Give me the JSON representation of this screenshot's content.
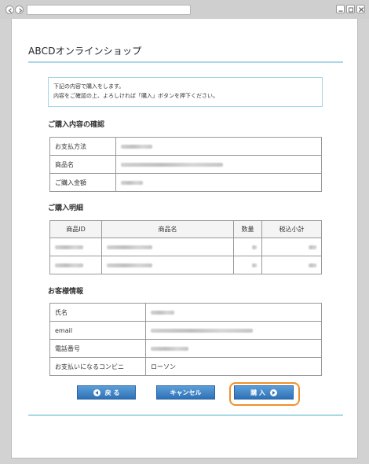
{
  "window": {
    "back_icon": "arrow-left-icon",
    "forward_icon": "arrow-right-icon",
    "controls": [
      "minimize-icon",
      "restore-icon",
      "close-icon"
    ]
  },
  "header": {
    "shop_name": "ABCDオンラインショップ"
  },
  "notice": {
    "line1": "下記の内容で購入をします。",
    "line2": "内容をご確認の上、よろしければ「購入」ボタンを押下ください。"
  },
  "confirm": {
    "heading": "ご購入内容の確認",
    "rows": [
      {
        "label": "お支払方法"
      },
      {
        "label": "商品名"
      },
      {
        "label": "ご購入金額"
      }
    ]
  },
  "detail": {
    "heading": "ご購入明細",
    "columns": [
      "商品ID",
      "商品名",
      "数量",
      "税込小計"
    ],
    "rows": 2
  },
  "customer": {
    "heading": "お客様情報",
    "rows": [
      {
        "label": "氏名",
        "value": ""
      },
      {
        "label": "email",
        "value": ""
      },
      {
        "label": "電話番号",
        "value": ""
      },
      {
        "label": "お支払いになるコンビニ",
        "value": "ローソン"
      }
    ]
  },
  "buttons": {
    "back": "戻 る",
    "cancel": "キャンセル",
    "purchase": "購 入"
  }
}
